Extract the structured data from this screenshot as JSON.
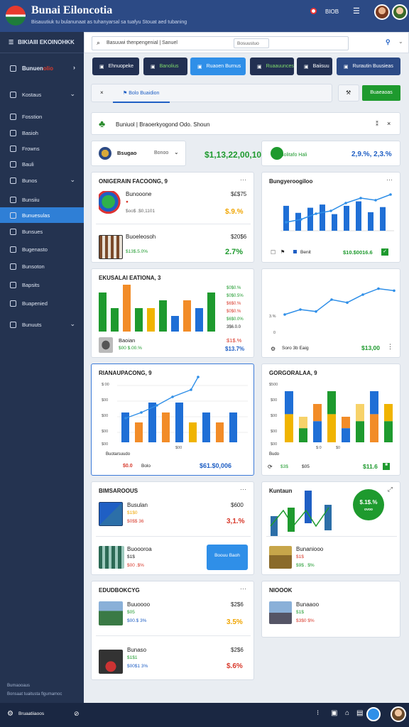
{
  "header": {
    "title": "Bunai Eiloncotia",
    "subtitle": "Bisauutiuk tu bulanunaat as tuhanyarsal sa tuafyu Stouat aed tubaning",
    "link": "BIOB",
    "menu_icon": "hamburger-icon"
  },
  "sidebar": {
    "title": "BIKIAIII EKOINOHKK",
    "brand": "Bunuen",
    "brand_suffix": "olio",
    "items": [
      {
        "label": "Kostaus",
        "icon": "home-icon",
        "chevron": true
      },
      {
        "label": "Fosstion",
        "icon": "clock-icon"
      },
      {
        "label": "Basioh",
        "icon": "grid-icon"
      },
      {
        "label": "Frowns",
        "icon": "document-icon"
      },
      {
        "label": "Bauli",
        "icon": "briefcase-icon"
      },
      {
        "label": "Bunos",
        "icon": "cart-icon",
        "chevron": true
      },
      {
        "label": "Bunsiiu",
        "icon": "user-icon"
      },
      {
        "label": "Bunuesulas",
        "icon": "edit-icon",
        "active": true
      },
      {
        "label": "Bunsues",
        "icon": "chart-icon"
      },
      {
        "label": "Bugenasto",
        "icon": "truck-icon"
      },
      {
        "label": "Bunsoton",
        "icon": "compass-icon"
      },
      {
        "label": "Bapsits",
        "icon": "tag-icon"
      },
      {
        "label": "Buapenied",
        "icon": "mail-icon"
      },
      {
        "label": "Bunuuts",
        "icon": "settings-icon",
        "chevron": true
      }
    ],
    "footer1": "Bumaooaus",
    "footer2": "Bonsaat tuaitusta flgumamoc"
  },
  "search": {
    "placeholder": "Basuuwi thenpengenial | Sanuel",
    "secondary": "Bosuustuo",
    "icon": "search-icon"
  },
  "tabs": [
    {
      "label": "Ehnuopeke"
    },
    {
      "label": "Banolius"
    },
    {
      "label": "Ruaoen Burnus",
      "active": true
    },
    {
      "label": "Ruaauunces"
    },
    {
      "label": "Baiisuu"
    },
    {
      "label": "Rurautin Buusieas"
    }
  ],
  "filter": {
    "label": "Bolo Buaidion",
    "button": "Buaeaoas"
  },
  "banner": {
    "text": "Buniuol | Braoerkyogond Odo. Shoun",
    "close": "×"
  },
  "kpi1": {
    "label": "Bsugao",
    "select": "Bonoo",
    "value": "$1,13,22,00,10"
  },
  "kpi2": {
    "label": "Bolitafo Hali",
    "value": "2,9.%, 2,3.%"
  },
  "cards": {
    "c1": {
      "title": "ONIGERAIN FACOONG, 9",
      "name": "Bunooone",
      "sub": "$oo$ .$0,1101",
      "price": "$£$75",
      "pct": "$.9.%"
    },
    "c1b": {
      "name": "Buoeleosoh",
      "sub": "$13$.5.0%",
      "price": "$20$6",
      "pct": "2.7%"
    },
    "c2": {
      "title": "Bungyeroogiloo",
      "legend": "Benit",
      "total": "$10.$0016.6"
    },
    "c3": {
      "title": "EKUSALAI EATIONA, 3",
      "v1": "$0$0.%",
      "v2": "$0$0.5%",
      "v3": "$6$0.%",
      "v4": "$0$0.%",
      "v5": "$6$0.0%",
      "v6": "3$6.0.0",
      "name": "Baoian",
      "sub": "$00 $.00.%",
      "p1": "$1$.%",
      "p2": "$13.7%"
    },
    "c4": {
      "y1": "3.%",
      "y2": "0",
      "foot": "Soro 3b Eaig",
      "total": "$13,00"
    },
    "c5": {
      "title": "RIANAUPACONG, 9",
      "y": [
        "$:00",
        "$00",
        "$00",
        "$00",
        "$00"
      ],
      "xl": "$00",
      "foot1": "Buotarsuudo",
      "foot2": "$0.0",
      "foot3": "Bolo",
      "total": "$61.$0,006"
    },
    "c6": {
      "title": "GORGORALAA, 9",
      "y": [
        "$500",
        "$00",
        "$00",
        "$00",
        "$00"
      ],
      "xl1": "$:0",
      "xl2": "$0",
      "foot1": "Budo",
      "foot2": "$3$",
      "foot3": "$05",
      "total": "$11.6"
    },
    "c7": {
      "title": "BIMSAROOUS",
      "name": "Busulan",
      "sub1": "$1$0",
      "sub2": "$0$$ 36",
      "price": "$600",
      "pct": "3,1.%"
    },
    "c7b": {
      "name": "Buoooroa",
      "sub1": "$1$",
      "sub2": "$00 .$%",
      "button": "Boouu Baoh"
    },
    "c8": {
      "title": "Kuntaun",
      "badge": "$.1$.%",
      "badge2": "ovoo"
    },
    "c8b": {
      "name": "Bunaniooo",
      "sub1": "$1$",
      "sub2": "$9$ . $%"
    },
    "c9": {
      "title": "EDUDBOKCYG",
      "name": "Buuoooo",
      "sub1": "$05",
      "sub2": "$00.$ 3%",
      "price": "$2$6",
      "pct": "3.5%"
    },
    "c9b": {
      "name": "Bunaso",
      "sub1": "$1$1",
      "sub2": "$00$1 3%",
      "price": "$2$6",
      "pct": "$.6%"
    },
    "c10": {
      "title": "NIOOOK",
      "name": "Bunaaoo",
      "sub1": "$1$",
      "sub2": "$3$0 $%"
    }
  },
  "bottom": {
    "label": "Bruaatiiaoos",
    "icons": [
      "share-icon",
      "window-icon",
      "cart-icon",
      "chat-icon"
    ]
  },
  "chart_data": [
    {
      "type": "bar",
      "series": [
        {
          "name": "",
          "values": [
            3.9,
            2.8,
            3.6,
            4.1,
            2.6,
            3.9,
            4.6,
            2.9,
            3.7
          ]
        }
      ]
    },
    {
      "type": "line",
      "values": [
        1.2,
        1.6,
        2.4,
        2.8,
        3.9,
        4.6,
        4.3,
        5.1
      ]
    },
    {
      "type": "bar",
      "values": [
        5,
        3,
        6,
        3,
        3,
        4,
        2,
        4,
        3,
        5
      ]
    },
    {
      "type": "line",
      "values": [
        1.0,
        1.5,
        1.3,
        2.5,
        2.2,
        3.0,
        3.6,
        3.4
      ]
    },
    {
      "type": "bar",
      "values": [
        3,
        2,
        4,
        3,
        4,
        2,
        3,
        2,
        3
      ]
    },
    {
      "type": "bar",
      "values": [
        4,
        2,
        3,
        4,
        2,
        3,
        4,
        3
      ]
    }
  ]
}
